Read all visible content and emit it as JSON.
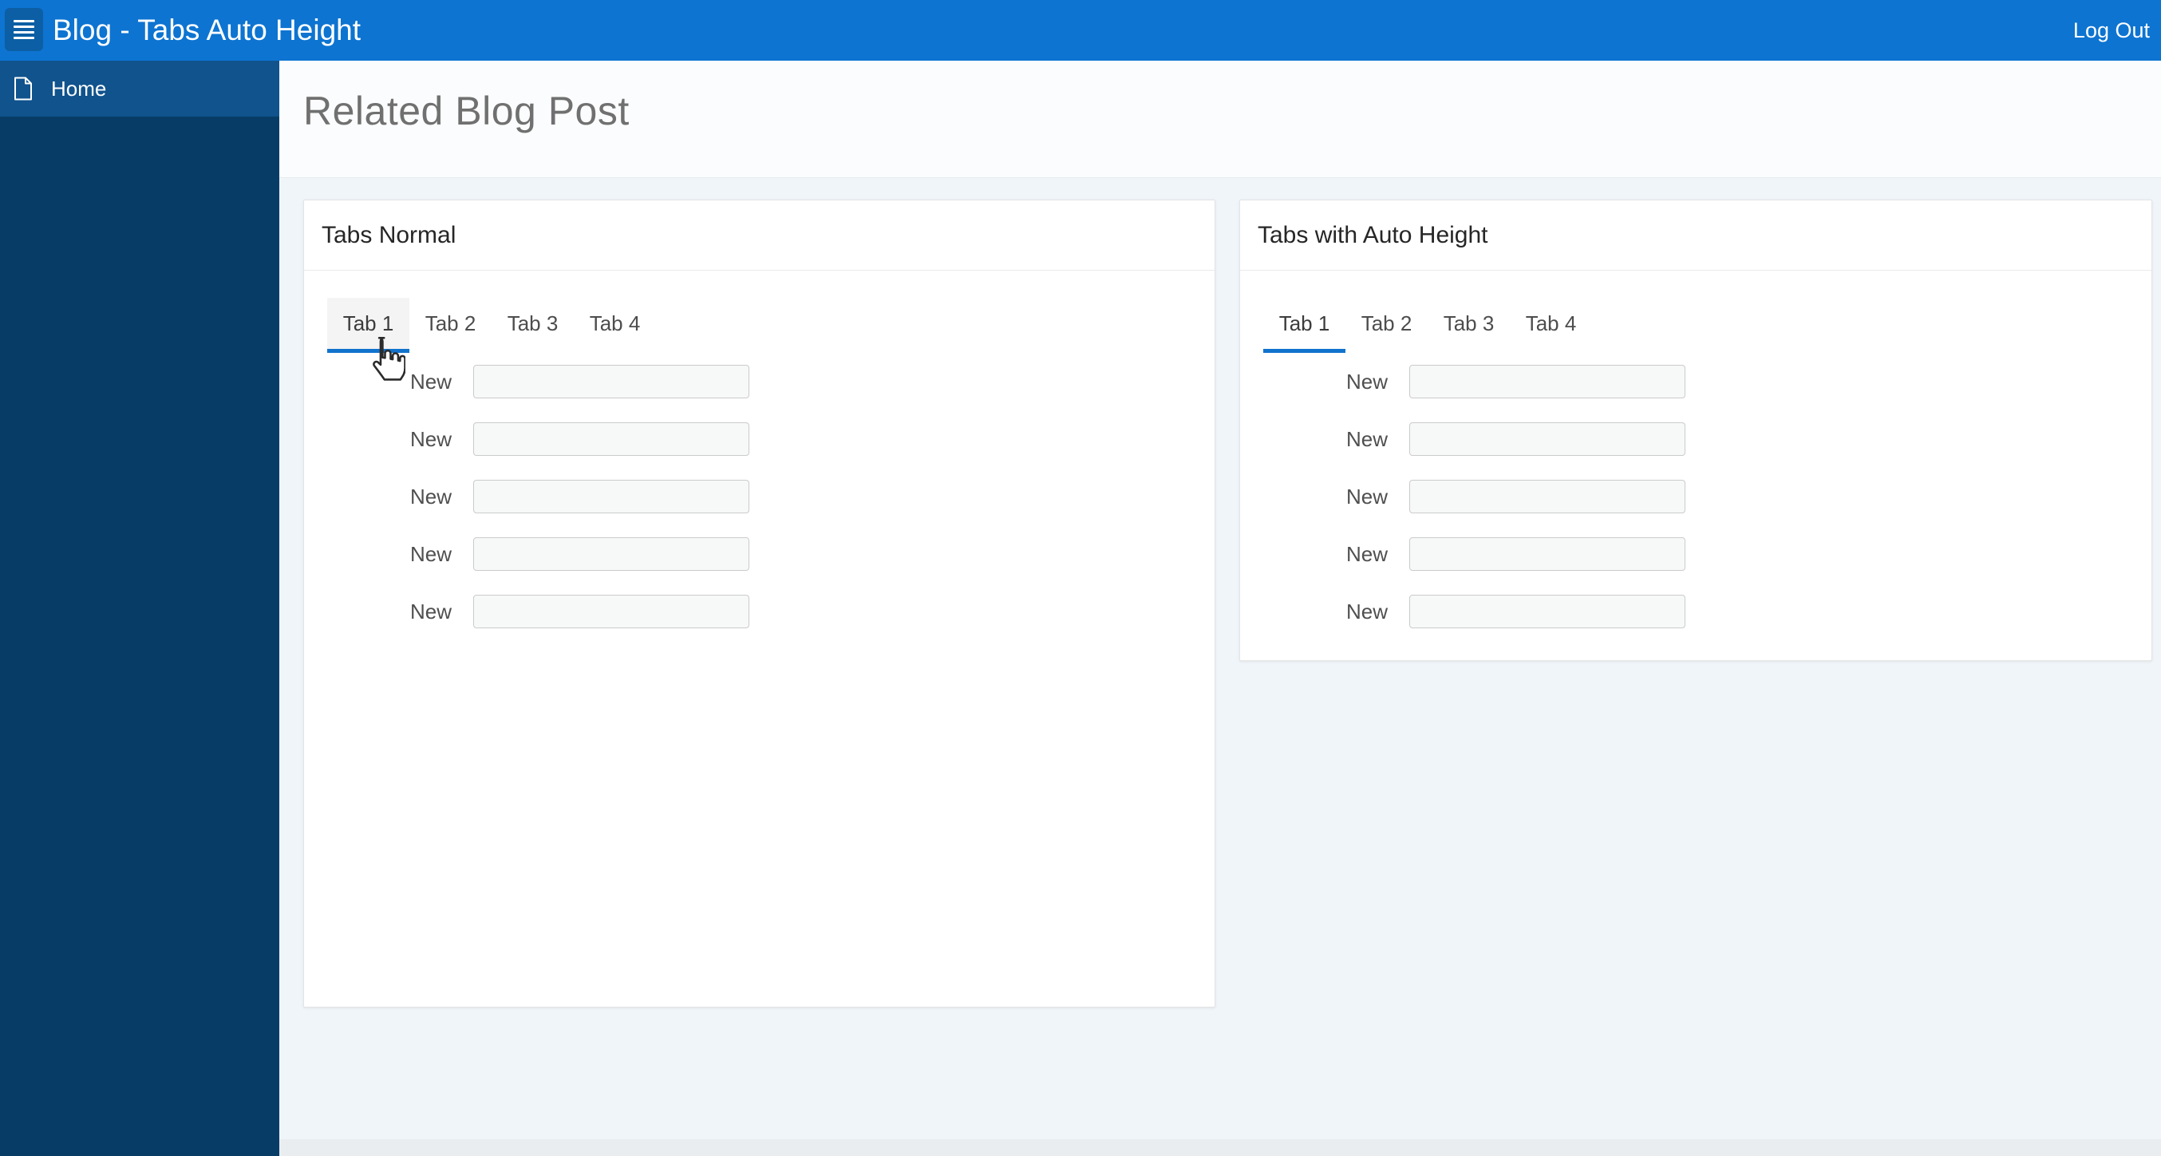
{
  "header": {
    "title": "Blog - Tabs Auto Height",
    "logout_label": "Log Out"
  },
  "sidebar": {
    "items": [
      {
        "label": "Home",
        "icon": "document-icon",
        "active": true
      }
    ]
  },
  "page": {
    "title": "Related Blog Post"
  },
  "cards": [
    {
      "title": "Tabs Normal",
      "tabs": [
        "Tab 1",
        "Tab 2",
        "Tab 3",
        "Tab 4"
      ],
      "active_tab": "Tab 1",
      "rows": [
        {
          "label": "New",
          "value": ""
        },
        {
          "label": "New",
          "value": ""
        },
        {
          "label": "New",
          "value": ""
        },
        {
          "label": "New",
          "value": ""
        },
        {
          "label": "New",
          "value": ""
        }
      ]
    },
    {
      "title": "Tabs with Auto Height",
      "tabs": [
        "Tab 1",
        "Tab 2",
        "Tab 3",
        "Tab 4"
      ],
      "active_tab": "Tab 1",
      "rows": [
        {
          "label": "New",
          "value": ""
        },
        {
          "label": "New",
          "value": ""
        },
        {
          "label": "New",
          "value": ""
        },
        {
          "label": "New",
          "value": ""
        },
        {
          "label": "New",
          "value": ""
        }
      ]
    }
  ],
  "cursor": {
    "type": "hand-pointer",
    "over": "Tab 1 of Tabs Normal"
  },
  "icons": {
    "menu": "menu-icon",
    "home": "document-icon",
    "pointer": "hand-pointer-icon"
  },
  "colors": {
    "header-blue": "#0d74d1",
    "header-button": "#0c5fa4",
    "sidebar-bg": "#073c66",
    "sidebar-active": "#10538d",
    "accent": "#1173cd",
    "content-bg": "#f0f5f9",
    "footer-bg": "#e9edf0"
  }
}
